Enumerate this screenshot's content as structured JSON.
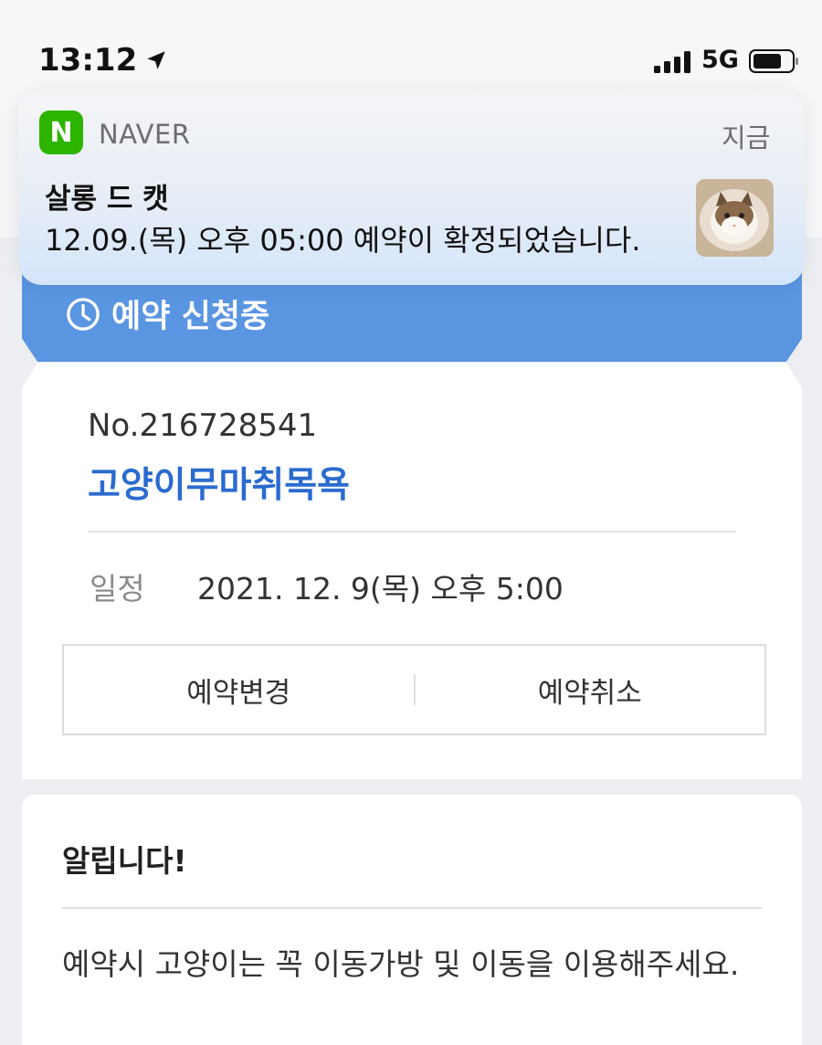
{
  "status_bar": {
    "time": "13:12",
    "network": "5G",
    "icons": [
      "location-arrow-icon",
      "signal-icon",
      "battery-icon"
    ]
  },
  "notification": {
    "app_icon_letter": "N",
    "app_name": "NAVER",
    "time": "지금",
    "title": "살롱 드 캣",
    "body": "12.09.(목) 오후 05:00 예약이 확정되었습니다."
  },
  "banner": {
    "status": "예약 신청중",
    "color": "#5a95e2"
  },
  "reservation": {
    "number": "No.216728541",
    "title": "고양이무마취목욕",
    "schedule_label": "일정",
    "schedule_value": "2021. 12. 9(목) 오후 5:00",
    "change_button": "예약변경",
    "cancel_button": "예약취소",
    "title_color": "#2a6bcf"
  },
  "notice": {
    "title": "알립니다!",
    "body": "예약시 고양이는 꼭 이동가방 및 이동을 이용해주세요."
  }
}
